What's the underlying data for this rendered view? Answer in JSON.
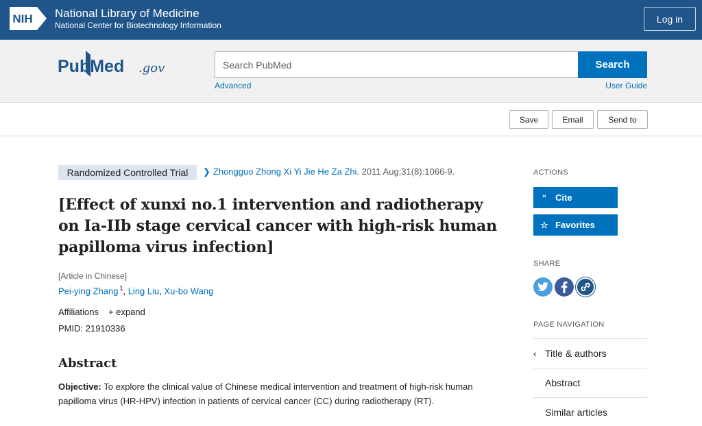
{
  "banner": {
    "logo_text": "NIH",
    "title": "National Library of Medicine",
    "subtitle": "National Center for Biotechnology Information",
    "login_label": "Log in"
  },
  "search": {
    "logo_text": "PubMed",
    "logo_suffix": ".gov",
    "placeholder": "Search PubMed",
    "button_label": "Search",
    "advanced_label": "Advanced",
    "user_guide_label": "User Guide"
  },
  "toolbar": {
    "save_label": "Save",
    "email_label": "Email",
    "send_to_label": "Send to"
  },
  "article": {
    "publication_type": "Randomized Controlled Trial",
    "journal": "Zhongguo Zhong Xi Yi Jie He Za Zhi.",
    "citation": " 2011 Aug;31(8):1066-9.",
    "title_lines": [
      "[Effect of xunxi no.1 intervention and radiotherapy",
      "on Ia-IIb stage cervical cancer with high-risk human",
      "papilloma virus infection]"
    ],
    "language_note": "[Article in Chinese]",
    "authors": [
      {
        "name": "Pei-ying Zhang",
        "sup": "1"
      },
      {
        "name": "Ling Liu",
        "sup": ""
      },
      {
        "name": "Xu-bo Wang",
        "sup": ""
      }
    ],
    "affiliations_label": "Affiliations",
    "expand_label": "+ expand",
    "pmid_label": "PMID: ",
    "pmid_value": "21910336",
    "abstract_heading": "Abstract",
    "abstract_objective_label": "Objective:",
    "abstract_objective_text": " To explore the clinical value of Chinese medical intervention and treatment of high-risk human papilloma virus (HR-HPV) infection in patients of cervical cancer (CC) during radiotherapy (RT)."
  },
  "sidebar": {
    "actions_label": "ACTIONS",
    "cite_label": "Cite",
    "favorites_label": "Favorites",
    "share_label": "SHARE",
    "share_icons": [
      "twitter-icon",
      "facebook-icon",
      "permalink-icon"
    ],
    "page_nav_label": "PAGE NAVIGATION",
    "nav_items": [
      "Title & authors",
      "Abstract",
      "Similar articles"
    ]
  },
  "colors": {
    "banner": "#20558a",
    "accent": "#0071bc",
    "twitter": "#4a9fe0",
    "facebook": "#3b5a9a",
    "permalink": "#20558a",
    "tag_bg": "#dce4ef"
  }
}
